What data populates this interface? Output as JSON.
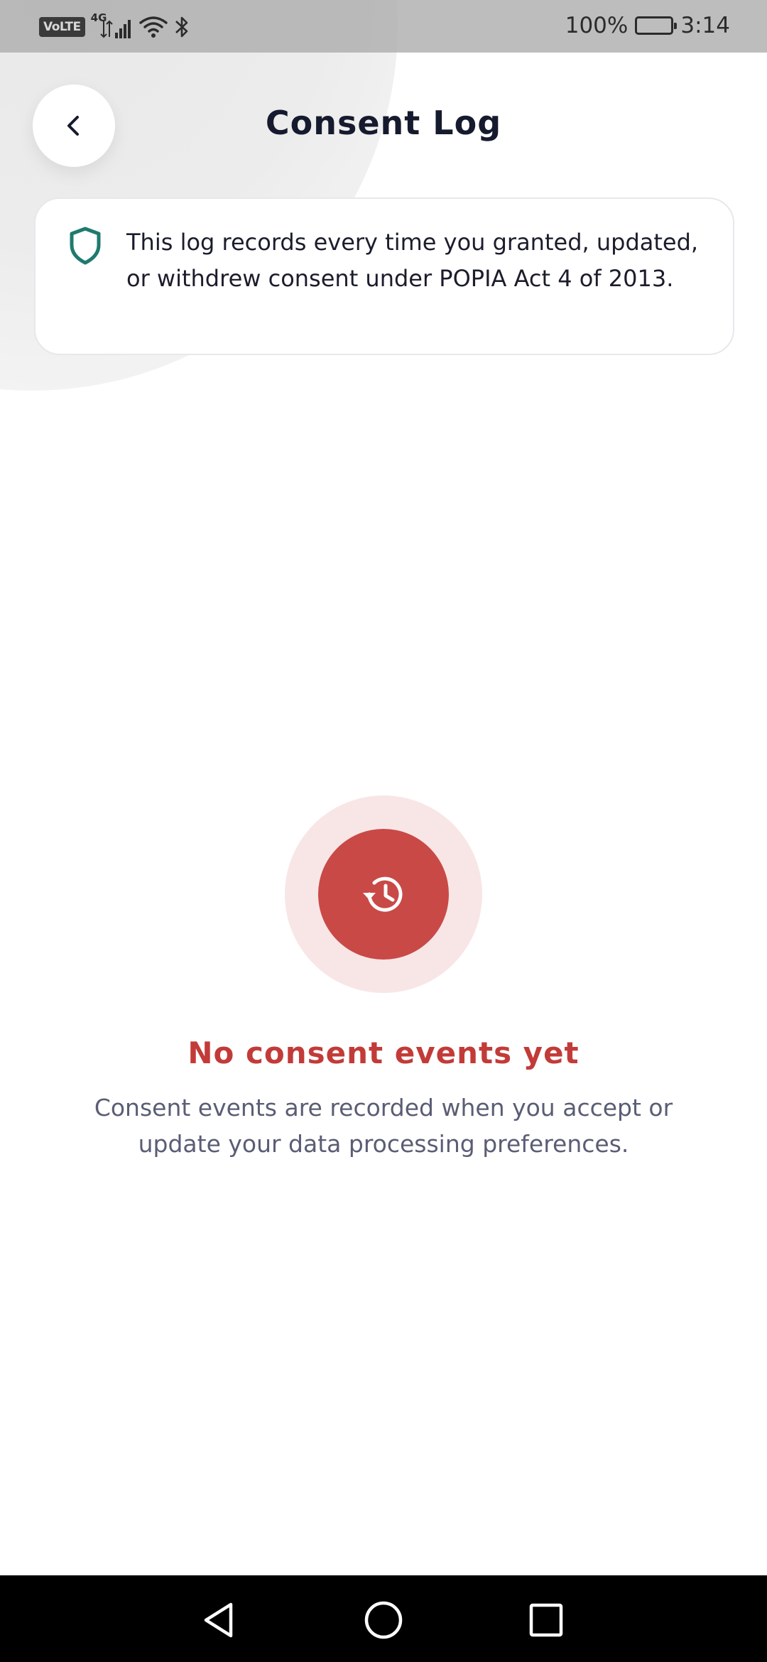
{
  "status_bar": {
    "volte": "VoLTE",
    "network": "4G",
    "battery_percent": "100%",
    "battery_level": 1.0,
    "time": "3:14"
  },
  "header": {
    "title": "Consent Log",
    "back_icon": "chevron-left-icon"
  },
  "info_card": {
    "icon": "shield-icon",
    "text": "This log records every time you granted, updated, or withdrew consent under POPIA Act 4 of 2013."
  },
  "empty_state": {
    "icon": "history-icon",
    "title": "No consent events yet",
    "description": "Consent events are recorded when you accept or update your data processing preferences."
  },
  "nav_bar": {
    "back_icon": "triangle-back-icon",
    "home_icon": "circle-home-icon",
    "recent_icon": "square-recent-icon"
  },
  "colors": {
    "accent": "#c94946",
    "accent_light": "#f8e6e6",
    "shield": "#1f7a6e",
    "title_text": "#161a2e",
    "muted_text": "#5a5d74"
  }
}
